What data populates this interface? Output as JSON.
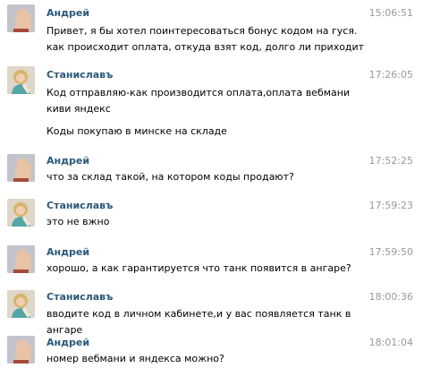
{
  "messages": [
    {
      "author": "Андрей",
      "time": "15:06:51",
      "lines": [
        "Привет, я бы хотел поинтересоваться бонус кодом на гуся. как происходит оплата, откуда взят код, долго ли приходит"
      ],
      "avatar_icon": "hand-avatar-icon"
    },
    {
      "author": "Станиславъ",
      "time": "17:26:05",
      "lines": [
        "Код отправляю-как производится оплата,оплата вебмани киви яндекс",
        "Коды покупаю в минске на складе"
      ],
      "avatar_icon": "woman-avatar-icon"
    },
    {
      "author": "Андрей",
      "time": "17:52:25",
      "lines": [
        "что за склад такой, на котором коды продают?"
      ],
      "avatar_icon": "hand-avatar-icon"
    },
    {
      "author": "Станиславъ",
      "time": "17:59:23",
      "lines": [
        "это не вжно"
      ],
      "avatar_icon": "woman-avatar-icon"
    },
    {
      "author": "Андрей",
      "time": "17:59:50",
      "lines": [
        "хорошо, а как гарантируется что танк появится в ангаре?"
      ],
      "avatar_icon": "hand-avatar-icon"
    },
    {
      "author": "Станиславъ",
      "time": "18:00:36",
      "lines": [
        "вводите код в личном кабинете,и у вас появляется танк в ангаре"
      ],
      "avatar_icon": "woman-avatar-icon"
    },
    {
      "author": "Андрей",
      "time": "18:01:04",
      "lines": [
        "номер вебмани и яндекса можно?"
      ],
      "avatar_icon": "hand-avatar-icon"
    }
  ],
  "colors": {
    "author_name": "#2b587a",
    "timestamp": "#999999",
    "text": "#000000",
    "background": "#ffffff"
  }
}
